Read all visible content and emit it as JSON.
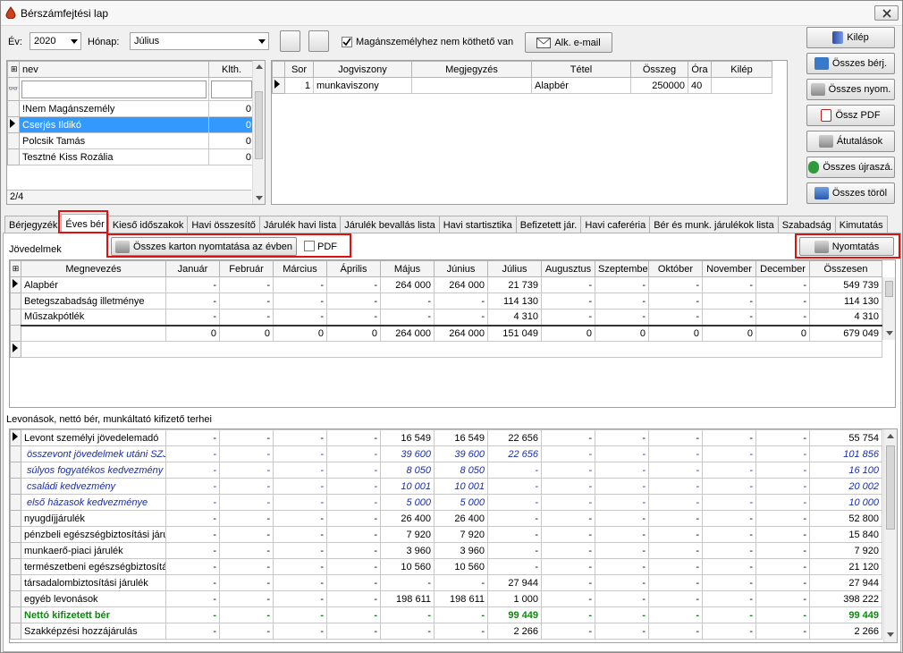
{
  "window": {
    "title": "Bérszámfejtési lap"
  },
  "top": {
    "ev_label": "Év:",
    "ev_value": "2020",
    "honap_label": "Hónap:",
    "honap_value": "Július",
    "checkbox_label": "Magánszemélyhez nem köthető van",
    "email_button": "Alk. e-mail"
  },
  "right_buttons": [
    "Kilép",
    "Összes bérj.",
    "Összes nyom.",
    "Össz PDF",
    "Átutalások",
    "Összes újraszá.",
    "Összes töröl"
  ],
  "person_list": {
    "headers": [
      "nev",
      "Klth."
    ],
    "rows": [
      [
        "!Nem Magánszemély",
        "0"
      ],
      [
        "Cserjés Ildikó",
        "0"
      ],
      [
        "Polcsik Tamás",
        "0"
      ],
      [
        "Tesztné Kiss Rozália",
        "0"
      ]
    ],
    "counter": "2/4"
  },
  "item_table": {
    "headers": [
      "Sor",
      "Jogviszony",
      "Megjegyzés",
      "Tétel",
      "Összeg",
      "Óra",
      "Kilép"
    ],
    "rows": [
      [
        "1",
        "munkaviszony",
        "",
        "Alapbér",
        "250000",
        "40",
        ""
      ]
    ]
  },
  "tabs": [
    "Bérjegyzék",
    "Éves bér",
    "Kieső időszakok",
    "Havi összesítő",
    "Járulék havi lista",
    "Járulék bevallás lista",
    "Havi startisztika",
    "Befizetett jár.",
    "Havi caferéria",
    "Bér és munk. járulékok lista",
    "Szabadság",
    "Kimutatás"
  ],
  "income": {
    "section_label": "Jövedelmek",
    "print_all_button": "Összes karton nyomtatása az évben",
    "pdf_label": "PDF",
    "print_button": "Nyomtatás",
    "headers": [
      "Megnevezés",
      "Január",
      "Február",
      "Március",
      "Április",
      "Május",
      "Június",
      "Július",
      "Augusztus",
      "Szeptember",
      "Október",
      "November",
      "December",
      "Összesen"
    ],
    "rows": [
      [
        "Alapbér",
        "-",
        "-",
        "-",
        "-",
        "264 000",
        "264 000",
        "21 739",
        "-",
        "-",
        "-",
        "-",
        "-",
        "549 739"
      ],
      [
        "Betegszabadság illetménye",
        "-",
        "-",
        "-",
        "-",
        "-",
        "-",
        "114 130",
        "-",
        "-",
        "-",
        "-",
        "-",
        "114 130"
      ],
      [
        "Műszakpótlék",
        "-",
        "-",
        "-",
        "-",
        "-",
        "-",
        "4 310",
        "-",
        "-",
        "-",
        "-",
        "-",
        "4 310"
      ]
    ],
    "totals": [
      "",
      "0",
      "0",
      "0",
      "0",
      "264 000",
      "264 000",
      "151 049",
      "0",
      "0",
      "0",
      "0",
      "0",
      "679 049"
    ]
  },
  "deductions": {
    "section_label": "Levonások, nettó bér, munkáltató kifizető terhei",
    "rows": [
      {
        "c": [
          "Levont személyi jövedelemadó",
          "-",
          "-",
          "-",
          "-",
          "16 549",
          "16 549",
          "22 656",
          "-",
          "-",
          "-",
          "-",
          "-",
          "55 754"
        ],
        "s": ""
      },
      {
        "c": [
          "összevont jövedelmek utáni SZJA",
          "-",
          "-",
          "-",
          "-",
          "39 600",
          "39 600",
          "22 656",
          "-",
          "-",
          "-",
          "-",
          "-",
          "101 856"
        ],
        "s": "i"
      },
      {
        "c": [
          "súlyos fogyatékos kedvezmény",
          "-",
          "-",
          "-",
          "-",
          "8 050",
          "8 050",
          "-",
          "-",
          "-",
          "-",
          "-",
          "-",
          "16 100"
        ],
        "s": "i"
      },
      {
        "c": [
          "családi kedvezmény",
          "-",
          "-",
          "-",
          "-",
          "10 001",
          "10 001",
          "-",
          "-",
          "-",
          "-",
          "-",
          "-",
          "20 002"
        ],
        "s": "i"
      },
      {
        "c": [
          "első házasok kedvezménye",
          "-",
          "-",
          "-",
          "-",
          "5 000",
          "5 000",
          "-",
          "-",
          "-",
          "-",
          "-",
          "-",
          "10 000"
        ],
        "s": "i"
      },
      {
        "c": [
          "nyugdíjjárulék",
          "-",
          "-",
          "-",
          "-",
          "26 400",
          "26 400",
          "-",
          "-",
          "-",
          "-",
          "-",
          "-",
          "52 800"
        ],
        "s": ""
      },
      {
        "c": [
          "pénzbeli egészségbiztosítási járulék",
          "-",
          "-",
          "-",
          "-",
          "7 920",
          "7 920",
          "-",
          "-",
          "-",
          "-",
          "-",
          "-",
          "15 840"
        ],
        "s": ""
      },
      {
        "c": [
          "munkaerő-piaci járulék",
          "-",
          "-",
          "-",
          "-",
          "3 960",
          "3 960",
          "-",
          "-",
          "-",
          "-",
          "-",
          "-",
          "7 920"
        ],
        "s": ""
      },
      {
        "c": [
          "természetbeni egészségbiztosítási járulék",
          "-",
          "-",
          "-",
          "-",
          "10 560",
          "10 560",
          "-",
          "-",
          "-",
          "-",
          "-",
          "-",
          "21 120"
        ],
        "s": ""
      },
      {
        "c": [
          "társadalombiztosítási járulék",
          "-",
          "-",
          "-",
          "-",
          "-",
          "-",
          "27 944",
          "-",
          "-",
          "-",
          "-",
          "-",
          "27 944"
        ],
        "s": ""
      },
      {
        "c": [
          "egyéb levonások",
          "-",
          "-",
          "-",
          "-",
          "198 611",
          "198 611",
          "1 000",
          "-",
          "-",
          "-",
          "-",
          "-",
          "398 222"
        ],
        "s": ""
      },
      {
        "c": [
          "Nettó kifizetett bér",
          "-",
          "-",
          "-",
          "-",
          "-",
          "-",
          "99 449",
          "-",
          "-",
          "-",
          "-",
          "-",
          "99 449"
        ],
        "s": "g"
      },
      {
        "c": [
          "Szakképzési hozzájárulás",
          "-",
          "-",
          "-",
          "-",
          "-",
          "-",
          "2 266",
          "-",
          "-",
          "-",
          "-",
          "-",
          "2 266"
        ],
        "s": ""
      }
    ]
  }
}
